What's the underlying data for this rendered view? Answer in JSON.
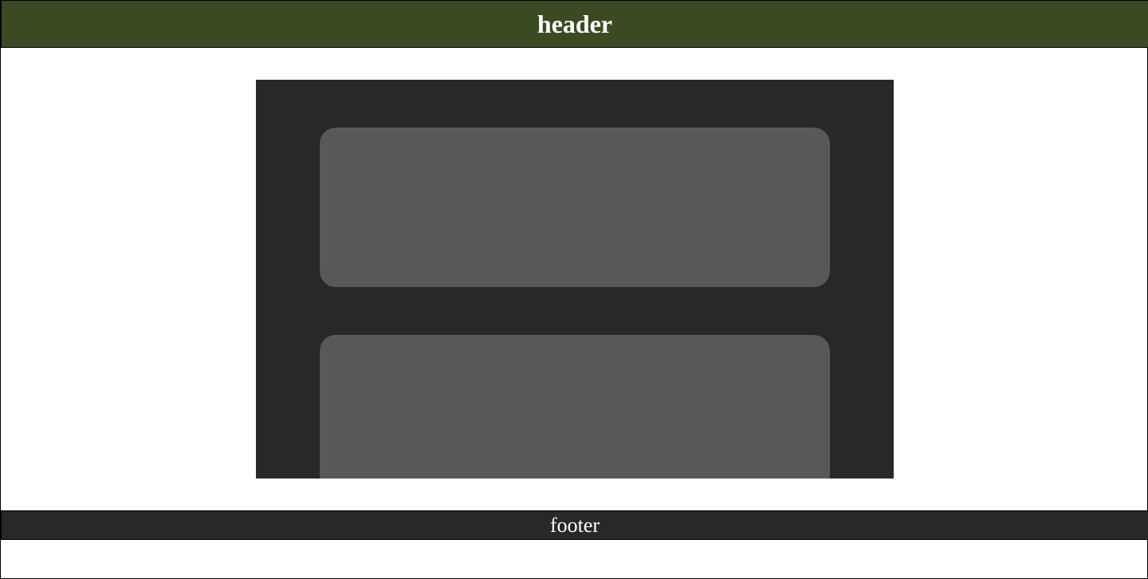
{
  "header": {
    "title": "header"
  },
  "main": {
    "cards": [
      {},
      {}
    ]
  },
  "footer": {
    "text": "footer"
  },
  "colors": {
    "header_bg": "#3a4b24",
    "main_bg": "#282828",
    "card_bg": "#585858",
    "footer_bg": "#282828",
    "text": "#ffffff"
  }
}
